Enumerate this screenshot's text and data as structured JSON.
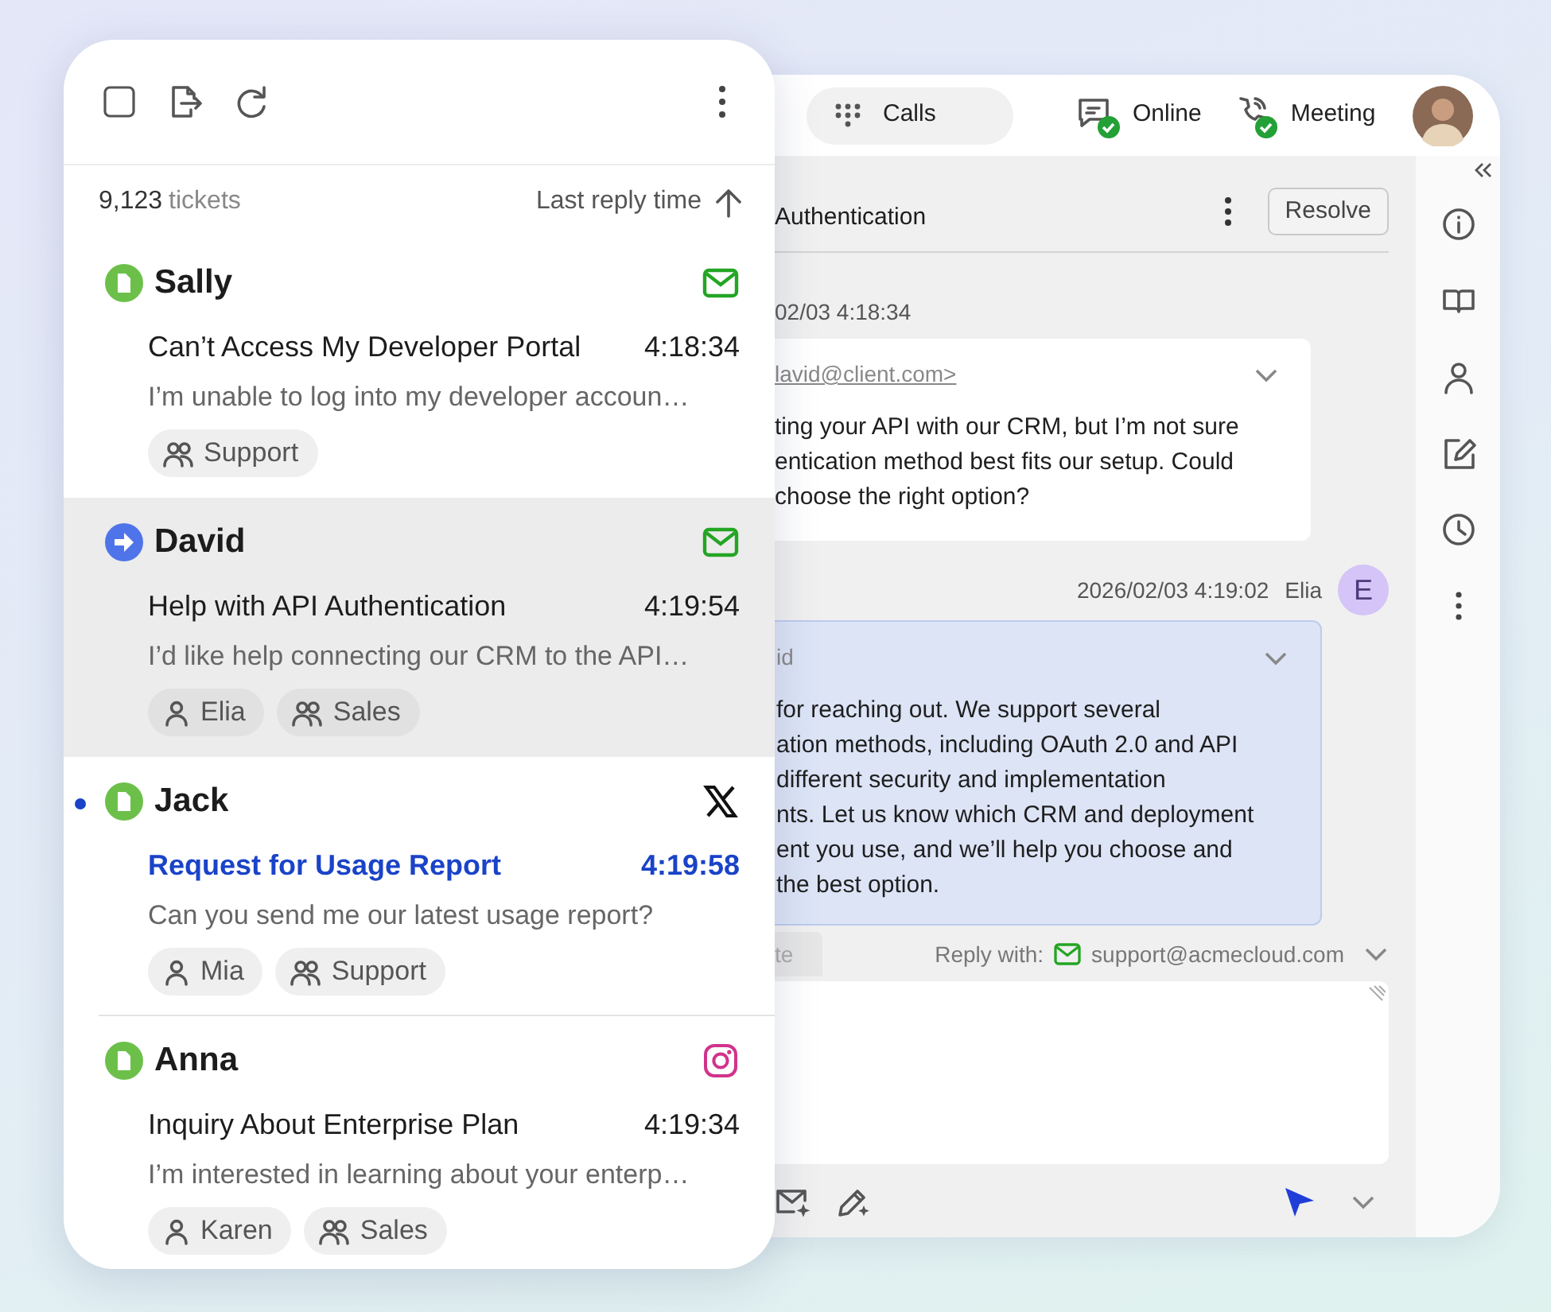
{
  "ticket_list": {
    "toolbar": {
      "select_all_checked": false
    },
    "count": "9,123",
    "count_label": "tickets",
    "sort": {
      "label": "Last reply time"
    },
    "tickets": [
      {
        "name": "Sally",
        "status_icon": {
          "kind": "document"
        },
        "channel_icon": {
          "kind": "email"
        },
        "subject": "Can’t Access My Developer Portal",
        "time": "4:18:34",
        "preview": "I’m unable to log into my developer accoun…",
        "tags": [
          {
            "kind": "group",
            "label": "Support"
          }
        ],
        "selected": false,
        "unread": false
      },
      {
        "name": "David",
        "status_icon": {
          "kind": "forwarded"
        },
        "channel_icon": {
          "kind": "email"
        },
        "subject": "Help with API Authentication",
        "time": "4:19:54",
        "preview": "I’d like help connecting our CRM to the API…",
        "tags": [
          {
            "kind": "person",
            "label": "Elia"
          },
          {
            "kind": "group",
            "label": "Sales"
          }
        ],
        "selected": true,
        "unread": false
      },
      {
        "name": "Jack",
        "status_icon": {
          "kind": "document"
        },
        "channel_icon": {
          "kind": "x"
        },
        "subject": "Request for Usage Report",
        "time": "4:19:58",
        "preview": "Can you send me our latest usage report?",
        "tags": [
          {
            "kind": "person",
            "label": "Mia"
          },
          {
            "kind": "group",
            "label": "Support"
          }
        ],
        "selected": false,
        "unread": true
      },
      {
        "name": "Anna",
        "status_icon": {
          "kind": "document"
        },
        "channel_icon": {
          "kind": "instagram"
        },
        "subject": "Inquiry About Enterprise Plan",
        "time": "4:19:34",
        "preview": "I’m interested in learning about your enterp…",
        "tags": [
          {
            "kind": "person",
            "label": "Karen"
          },
          {
            "kind": "group",
            "label": "Sales"
          }
        ],
        "selected": false,
        "unread": false
      }
    ]
  },
  "conversation": {
    "top_bar": {
      "calls": "Calls",
      "statuses": [
        {
          "kind": "chat",
          "label": "Online"
        },
        {
          "kind": "phone",
          "label": "Meeting"
        }
      ]
    },
    "title": "Authentication",
    "resolve": "Resolve",
    "messages": [
      {
        "kind": "incoming",
        "time": "02/03 4:18:34",
        "sender": "lavid@client.com>",
        "lines": [
          "ting your API with our CRM, but I’m not sure",
          "entication method best fits our setup. Could",
          "choose the right option?"
        ]
      },
      {
        "kind": "outgoing",
        "time": "2026/02/03 4:19:02",
        "author": "Elia",
        "initial": "E",
        "sender": "id",
        "lines": [
          "for reaching out. We support several",
          "ation methods, including OAuth 2.0 and API",
          "different security and implementation",
          "nts. Let us know which CRM and deployment",
          "ent you use, and we’ll help you choose and",
          "the best option."
        ]
      }
    ],
    "reply": {
      "tab": "te",
      "label": "Reply with:",
      "address": "support@acmecloud.com"
    }
  }
}
